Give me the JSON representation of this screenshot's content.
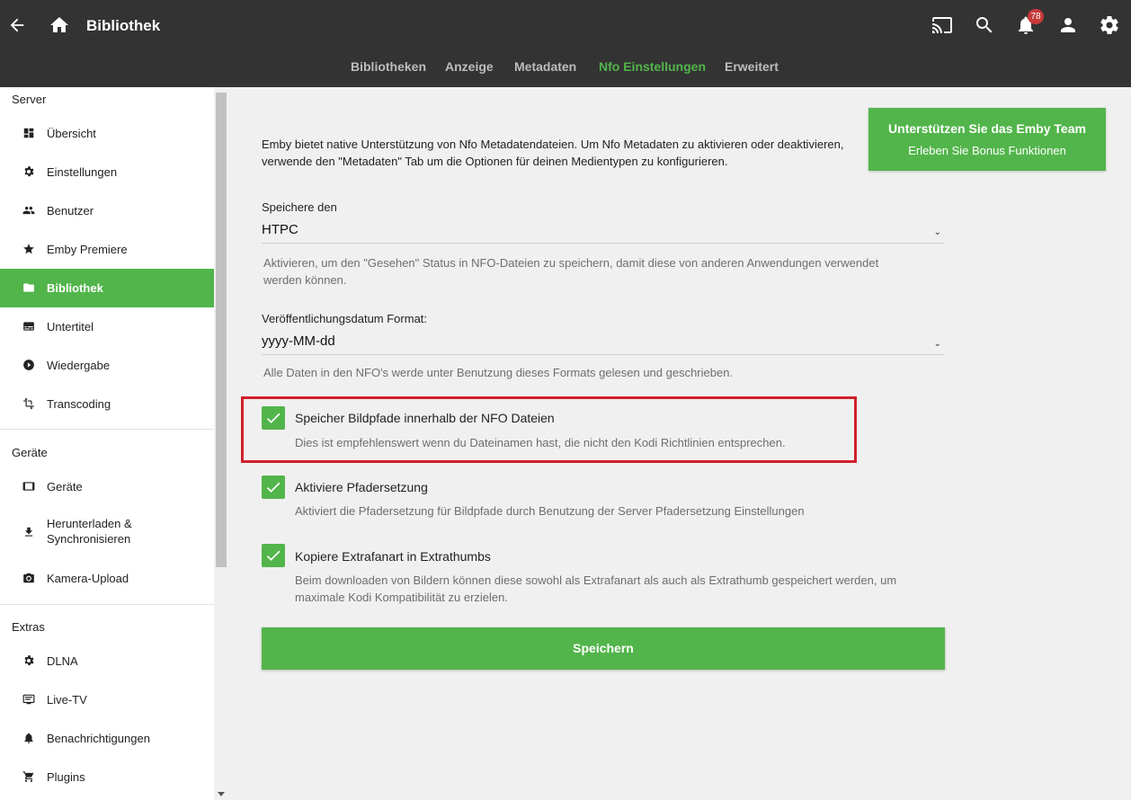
{
  "header": {
    "title": "Bibliothek",
    "notification_count": "78",
    "icons": [
      "back-arrow-icon",
      "home-icon",
      "cast-icon",
      "search-icon",
      "bell-icon",
      "user-icon",
      "gear-icon"
    ]
  },
  "tabs": [
    {
      "label": "Bibliotheken",
      "active": false
    },
    {
      "label": "Anzeige",
      "active": false
    },
    {
      "label": "Metadaten",
      "active": false
    },
    {
      "label": "Nfo Einstellungen",
      "active": true
    },
    {
      "label": "Erweitert",
      "active": false
    }
  ],
  "sidebar": {
    "server_section": "Server",
    "server_items": [
      {
        "label": "Übersicht",
        "icon": "dashboard-icon"
      },
      {
        "label": "Einstellungen",
        "icon": "settings-icon"
      },
      {
        "label": "Benutzer",
        "icon": "people-icon"
      },
      {
        "label": "Emby Premiere",
        "icon": "star-icon"
      },
      {
        "label": "Bibliothek",
        "icon": "folder-icon",
        "active": true
      },
      {
        "label": "Untertitel",
        "icon": "subtitles-icon"
      },
      {
        "label": "Wiedergabe",
        "icon": "play-circle-icon"
      },
      {
        "label": "Transcoding",
        "icon": "transform-icon"
      }
    ],
    "devices_section": "Geräte",
    "devices_items": [
      {
        "label": "Geräte",
        "icon": "tablet-icon"
      },
      {
        "label": "Herunterladen & Synchronisieren",
        "icon": "download-icon"
      },
      {
        "label": "Kamera-Upload",
        "icon": "camera-icon"
      }
    ],
    "extras_section": "Extras",
    "extras_items": [
      {
        "label": "DLNA",
        "icon": "settings-icon"
      },
      {
        "label": "Live-TV",
        "icon": "tv-icon"
      },
      {
        "label": "Benachrichtigungen",
        "icon": "bell-icon"
      },
      {
        "label": "Plugins",
        "icon": "cart-icon"
      }
    ]
  },
  "support": {
    "line1": "Unterstützen Sie das Emby Team",
    "line2": "Erleben Sie Bonus Funktionen"
  },
  "main": {
    "intro_line1": "Emby bietet native Unterstützung von Nfo Metadatendateien. Um Nfo Metadaten zu aktivieren oder deaktivieren,",
    "intro_line2": "verwende den \"Metadaten\" Tab um die Optionen für deinen Medientypen zu konfigurieren.",
    "save_for_label": "Speichere den",
    "save_for_value": "HTPC",
    "save_for_desc_line1": "Aktivieren, um den \"Gesehen\" Status in NFO-Dateien zu speichern, damit diese von anderen Anwendungen verwendet",
    "save_for_desc_line2": "werden können.",
    "date_format_label": "Veröffentlichungsdatum Format:",
    "date_format_value": "yyyy-MM-dd",
    "date_format_desc": "Alle Daten in den NFO's werde unter Benutzung dieses Formats gelesen und geschrieben.",
    "checkboxes": [
      {
        "label": "Speicher Bildpfade innerhalb der NFO Dateien",
        "desc_line1": "Dies ist empfehlenswert wenn du Dateinamen hast, die nicht den Kodi Richtlinien entsprechen.",
        "desc_line2": "",
        "checked": true
      },
      {
        "label": "Aktiviere Pfadersetzung",
        "desc_line1": "Aktiviert die Pfadersetzung für Bildpfade durch Benutzung der Server Pfadersetzung Einstellungen",
        "desc_line2": "",
        "checked": true
      },
      {
        "label": "Kopiere Extrafanart in Extrathumbs",
        "desc_line1": "Beim downloaden von Bildern können diese sowohl als Extrafanart als auch als Extrathumb gespeichert werden, um",
        "desc_line2": "maximale Kodi Kompatibilität zu erzielen.",
        "checked": true
      }
    ],
    "save_button": "Speichern"
  },
  "colors": {
    "accent": "#52b54b",
    "header_bg": "#333333",
    "highlight_border": "#d0202a"
  }
}
